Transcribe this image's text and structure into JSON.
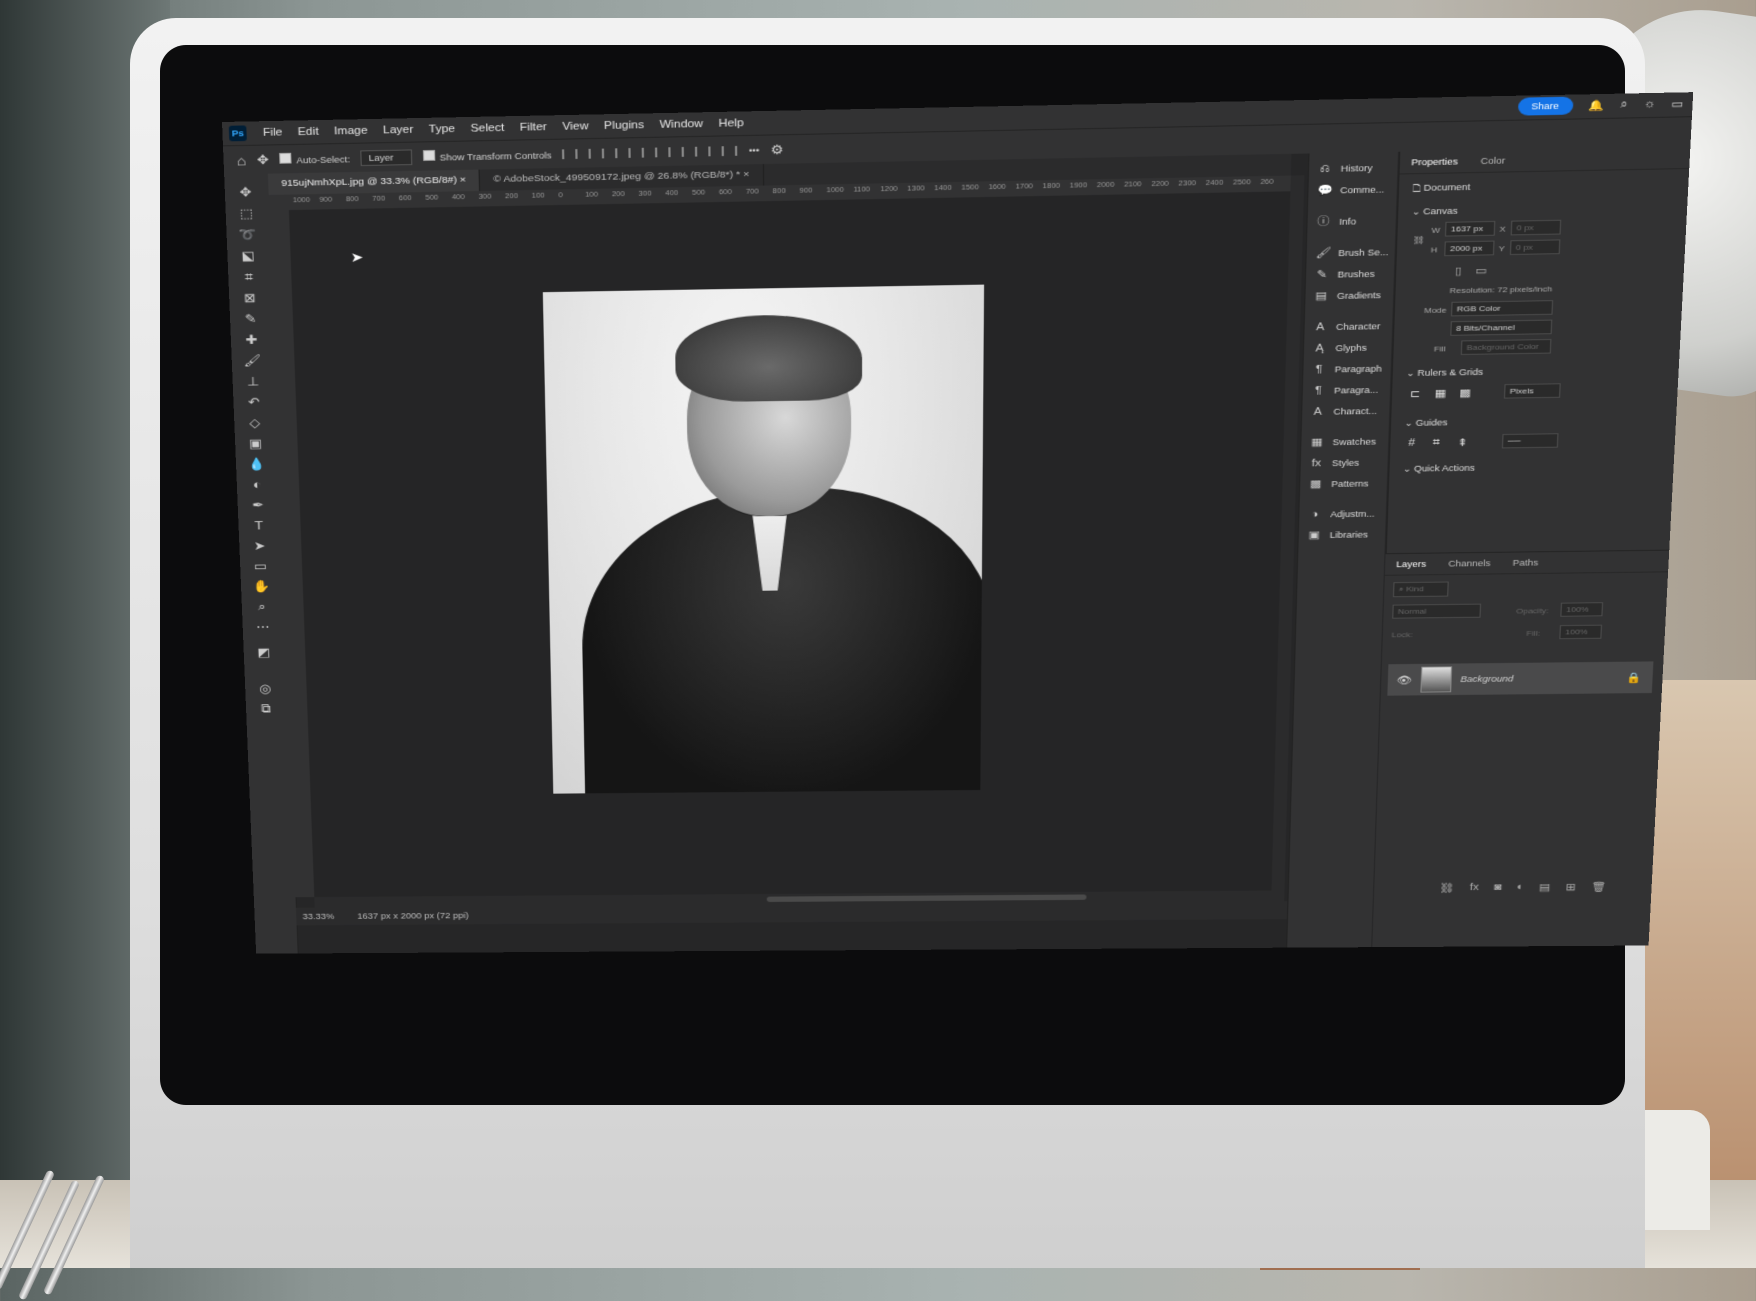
{
  "app": {
    "logo": "Ps",
    "menu": [
      "File",
      "Edit",
      "Image",
      "Layer",
      "Type",
      "Select",
      "Filter",
      "View",
      "Plugins",
      "Window",
      "Help"
    ],
    "share_label": "Share",
    "window_controls": [
      "–",
      "□",
      "✕"
    ]
  },
  "options_bar": {
    "auto_select_label": "Auto-Select:",
    "auto_select_value": "Layer",
    "transform_label": "Show Transform Controls",
    "more_label": "•••"
  },
  "document_tabs": [
    {
      "label": "915ujNmhXpL.jpg @ 33.3% (RGB/8#)",
      "close": "×"
    },
    {
      "label": "© AdobeStock_499509172.jpeg @ 26.8% (RGB/8*) *",
      "close": "×"
    }
  ],
  "ruler": {
    "ticks": [
      "1000",
      "900",
      "800",
      "700",
      "600",
      "500",
      "400",
      "300",
      "200",
      "100",
      "0",
      "100",
      "200",
      "300",
      "400",
      "500",
      "600",
      "700",
      "800",
      "900",
      "1000",
      "1100",
      "1200",
      "1300",
      "1400",
      "1500",
      "1600",
      "1700",
      "1800",
      "1900",
      "2000",
      "2100",
      "2200",
      "2300",
      "2400",
      "2500",
      "260"
    ]
  },
  "status": {
    "zoom": "33.33%",
    "doc_info": "1637 px x 2000 px (72 ppi)"
  },
  "dock": [
    {
      "icon": "history-icon",
      "label": "History"
    },
    {
      "icon": "comments-icon",
      "label": "Comme..."
    },
    {
      "icon": "info-icon",
      "label": "Info"
    },
    {
      "icon": "brush-settings-icon",
      "label": "Brush Se..."
    },
    {
      "icon": "brushes-icon",
      "label": "Brushes"
    },
    {
      "icon": "gradients-icon",
      "label": "Gradients"
    },
    {
      "icon": "character-icon",
      "label": "Character"
    },
    {
      "icon": "glyphs-icon",
      "label": "Glyphs"
    },
    {
      "icon": "paragraph-icon",
      "label": "Paragraph"
    },
    {
      "icon": "paragraph-styles-icon",
      "label": "Paragra..."
    },
    {
      "icon": "character-styles-icon",
      "label": "Charact..."
    },
    {
      "icon": "swatches-icon",
      "label": "Swatches"
    },
    {
      "icon": "styles-icon",
      "label": "Styles"
    },
    {
      "icon": "patterns-icon",
      "label": "Patterns"
    },
    {
      "icon": "adjustments-icon",
      "label": "Adjustm..."
    },
    {
      "icon": "libraries-icon",
      "label": "Libraries"
    }
  ],
  "properties": {
    "tabs": [
      "Properties",
      "Color"
    ],
    "document_label": "Document",
    "canvas_label": "Canvas",
    "w_label": "W",
    "w_value": "1637 px",
    "h_label": "H",
    "h_value": "2000 px",
    "x_label": "X",
    "x_value": "0 px",
    "y_label": "Y",
    "y_value": "0 px",
    "resolution": "Resolution: 72 pixels/inch",
    "mode_label": "Mode",
    "mode_value": "RGB Color",
    "bits_value": "8 Bits/Channel",
    "fill_label": "Fill",
    "fill_value": "Background Color",
    "rulers_label": "Rulers & Grids",
    "units_value": "Pixels",
    "guides_label": "Guides",
    "quick_actions_label": "Quick Actions"
  },
  "layers": {
    "tabs": [
      "Layers",
      "Channels",
      "Paths"
    ],
    "search_placeholder": "Kind",
    "blend_mode": "Normal",
    "opacity_label": "Opacity:",
    "opacity_value": "100%",
    "lock_label": "Lock:",
    "fill_label": "Fill:",
    "fill_value": "100%",
    "items": [
      {
        "name": "Background",
        "visible": true,
        "locked": true
      }
    ]
  },
  "colors": {
    "accent": "#1473e6",
    "panel": "#323233",
    "canvas": "#262627"
  }
}
